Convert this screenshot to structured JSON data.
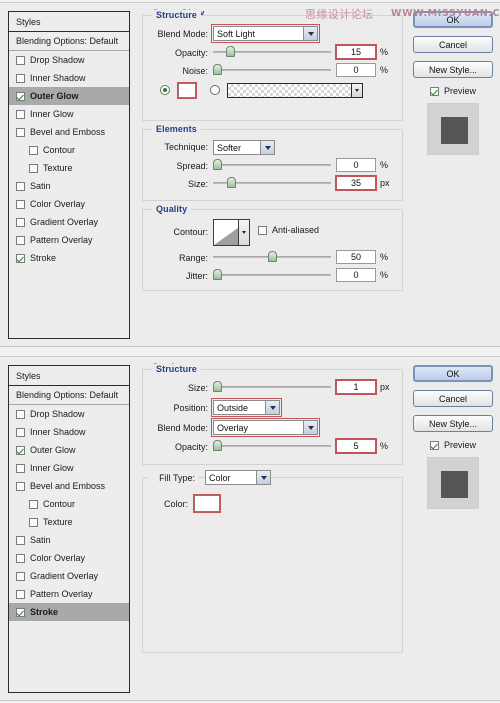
{
  "watermark": {
    "cn": "思缘设计论坛",
    "url": "WWW.MISSYUAN.COM"
  },
  "styles_panel": {
    "header": "Styles",
    "blending_options": "Blending Options: Default",
    "items": [
      {
        "label": "Drop Shadow",
        "checked": false,
        "indent": false
      },
      {
        "label": "Inner Shadow",
        "checked": false,
        "indent": false
      },
      {
        "label": "Outer Glow",
        "checked": true,
        "indent": false
      },
      {
        "label": "Inner Glow",
        "checked": false,
        "indent": false
      },
      {
        "label": "Bevel and Emboss",
        "checked": false,
        "indent": false
      },
      {
        "label": "Contour",
        "checked": false,
        "indent": true
      },
      {
        "label": "Texture",
        "checked": false,
        "indent": true
      },
      {
        "label": "Satin",
        "checked": false,
        "indent": false
      },
      {
        "label": "Color Overlay",
        "checked": false,
        "indent": false
      },
      {
        "label": "Gradient Overlay",
        "checked": false,
        "indent": false
      },
      {
        "label": "Pattern Overlay",
        "checked": false,
        "indent": false
      },
      {
        "label": "Stroke",
        "checked": true,
        "indent": false
      }
    ]
  },
  "buttons": {
    "ok": "OK",
    "cancel": "Cancel",
    "new_style": "New Style...",
    "preview": "Preview",
    "preview_checked": true
  },
  "dialog_outer_glow": {
    "title": "Outer Glow",
    "selected_style": "Outer Glow",
    "structure": {
      "title": "Structure",
      "blend_mode_label": "Blend Mode:",
      "blend_mode_value": "Soft Light",
      "opacity_label": "Opacity:",
      "opacity_value": "15",
      "opacity_unit": "%",
      "noise_label": "Noise:",
      "noise_value": "0",
      "noise_unit": "%",
      "fill_mode": "color",
      "color_swatch": "#ffffff"
    },
    "elements": {
      "title": "Elements",
      "technique_label": "Technique:",
      "technique_value": "Softer",
      "spread_label": "Spread:",
      "spread_value": "0",
      "spread_unit": "%",
      "size_label": "Size:",
      "size_value": "35",
      "size_unit": "px"
    },
    "quality": {
      "title": "Quality",
      "contour_label": "Contour:",
      "anti_aliased_label": "Anti-aliased",
      "anti_aliased_checked": false,
      "range_label": "Range:",
      "range_value": "50",
      "range_unit": "%",
      "jitter_label": "Jitter:",
      "jitter_value": "0",
      "jitter_unit": "%"
    }
  },
  "dialog_stroke": {
    "title": "Stroke",
    "selected_style": "Stroke",
    "structure": {
      "title": "Structure",
      "size_label": "Size:",
      "size_value": "1",
      "size_unit": "px",
      "position_label": "Position:",
      "position_value": "Outside",
      "blend_mode_label": "Blend Mode:",
      "blend_mode_value": "Overlay",
      "opacity_label": "Opacity:",
      "opacity_value": "5",
      "opacity_unit": "%"
    },
    "fill": {
      "fill_type_label": "Fill Type:",
      "fill_type_value": "Color",
      "color_label": "Color:",
      "color_swatch": "#ffffff"
    }
  },
  "colors": {
    "accent_heading": "#243e8c",
    "highlight_red": "#c0565c",
    "selection_gray": "#a9a9ac",
    "dialog_bg": "#ececec"
  }
}
